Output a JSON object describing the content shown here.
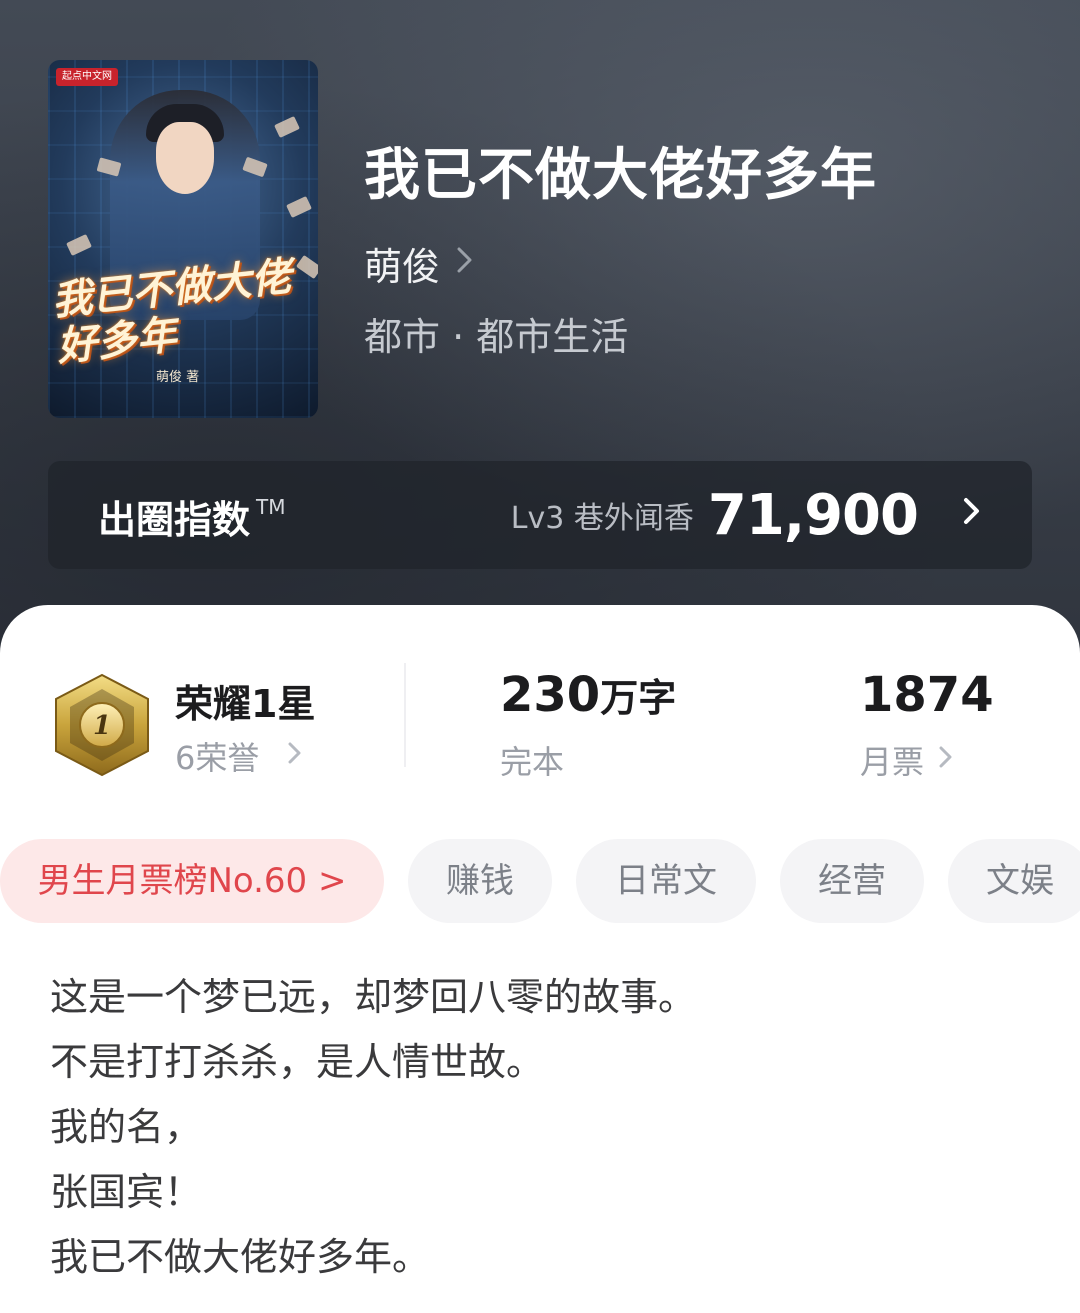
{
  "book": {
    "cover": {
      "publisher": "起点中文网",
      "title_art": "我已不做大佬好多年",
      "author_art": "萌俊 著"
    },
    "title": "我已不做大佬好多年",
    "author": "萌俊",
    "genre": "都市 · 都市生活"
  },
  "index": {
    "label": "出圈指数",
    "tm": "TM",
    "level": "Lv3 巷外闻香",
    "value": "71,900"
  },
  "stats": {
    "honor": {
      "title": "荣耀1星",
      "sub": "6荣誉",
      "medal_number": "1"
    },
    "words": {
      "value": "230",
      "unit": "万字",
      "status": "完本"
    },
    "votes": {
      "value": "1874",
      "label": "月票"
    }
  },
  "tags": [
    {
      "label": "男生月票榜No.60 >",
      "type": "rank"
    },
    {
      "label": "赚钱",
      "type": "tag"
    },
    {
      "label": "日常文",
      "type": "tag"
    },
    {
      "label": "经营",
      "type": "tag"
    },
    {
      "label": "文娱",
      "type": "tag"
    }
  ],
  "intro": [
    "这是一个梦已远，却梦回八零的故事。",
    "不是打打杀杀，是人情世故。",
    "我的名，",
    "张国宾！",
    "我已不做大佬好多年。"
  ],
  "colors": {
    "rank_tag_bg": "#fde8e8",
    "rank_tag_text": "#e0464c",
    "medal_gold": "#c9a43c"
  }
}
